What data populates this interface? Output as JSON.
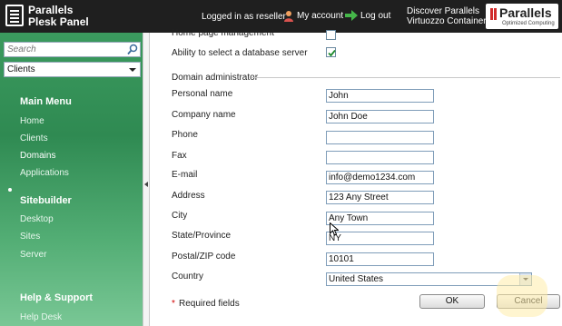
{
  "header": {
    "product_line1": "Parallels",
    "product_line2": "Plesk Panel",
    "logged_in": "Logged in as reseller",
    "my_account": "My account",
    "log_out": "Log out",
    "discover_line1": "Discover Parallels",
    "discover_line2": "Virtuozzo Containers",
    "brand_logo_text": "Parallels",
    "brand_logo_sub": "Optimized Computing"
  },
  "sidebar": {
    "search_placeholder": "Search",
    "context_value": "Clients",
    "main_menu_title": "Main Menu",
    "main_items": [
      "Home",
      "Clients",
      "Domains",
      "Applications"
    ],
    "sitebuilder_title": "Sitebuilder",
    "sitebuilder_items": [
      "Desktop",
      "Sites",
      "Server"
    ],
    "help_title": "Help & Support",
    "help_items": [
      "Help Desk"
    ]
  },
  "form": {
    "partial_row_label": "Home page management",
    "db_server_label": "Ability to select a database server",
    "section_title": "Domain administrator",
    "fields": {
      "personal_name": {
        "label": "Personal name",
        "value": "John"
      },
      "company_name": {
        "label": "Company name",
        "value": "John Doe"
      },
      "phone": {
        "label": "Phone",
        "value": ""
      },
      "fax": {
        "label": "Fax",
        "value": ""
      },
      "email": {
        "label": "E-mail",
        "value": "info@demo1234.com"
      },
      "address": {
        "label": "Address",
        "value": "123 Any Street"
      },
      "city": {
        "label": "City",
        "value": "Any Town"
      },
      "state": {
        "label": "State/Province",
        "value": "NY"
      },
      "postal": {
        "label": "Postal/ZIP code",
        "value": "10101"
      }
    },
    "country_label": "Country",
    "country_value": "United States",
    "required_star": "*",
    "required_text": "Required fields",
    "ok_label": "OK",
    "cancel_label": "Cancel"
  },
  "colors": {
    "header_bg": "#1f1f1f",
    "sidebar_green": "#3b9a5e",
    "logo_red": "#d12a2a",
    "required_red": "#d10000"
  }
}
